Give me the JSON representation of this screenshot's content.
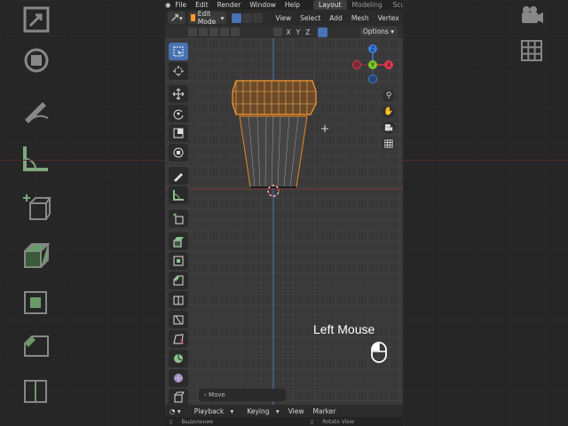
{
  "topbar": {
    "menus": [
      "File",
      "Edit",
      "Render",
      "Window",
      "Help"
    ],
    "workspaces": [
      "Layout",
      "Modeling",
      "Sculpting"
    ],
    "active_workspace": "Layout"
  },
  "header": {
    "mode": "Edit Mode",
    "menus": [
      "View",
      "Select",
      "Add",
      "Mesh",
      "Vertex"
    ]
  },
  "header2": {
    "axes": [
      "X",
      "Y",
      "Z"
    ],
    "options": "Options"
  },
  "gizmo": {
    "x": "X",
    "y": "Y",
    "z": "Z"
  },
  "overlay": {
    "text": "Left Mouse"
  },
  "operator_panel": {
    "label": "Move"
  },
  "timeline": {
    "items": [
      "Playback",
      "Keying",
      "View",
      "Marker"
    ]
  },
  "statusbar": {
    "left": "Выделение",
    "right": "Rotate View"
  },
  "colors": {
    "accent": "#4772b3",
    "selected": "#ff8c1a",
    "x_axis": "#e0384d",
    "y_axis": "#7ec82a",
    "z_axis": "#3a7ee0"
  }
}
